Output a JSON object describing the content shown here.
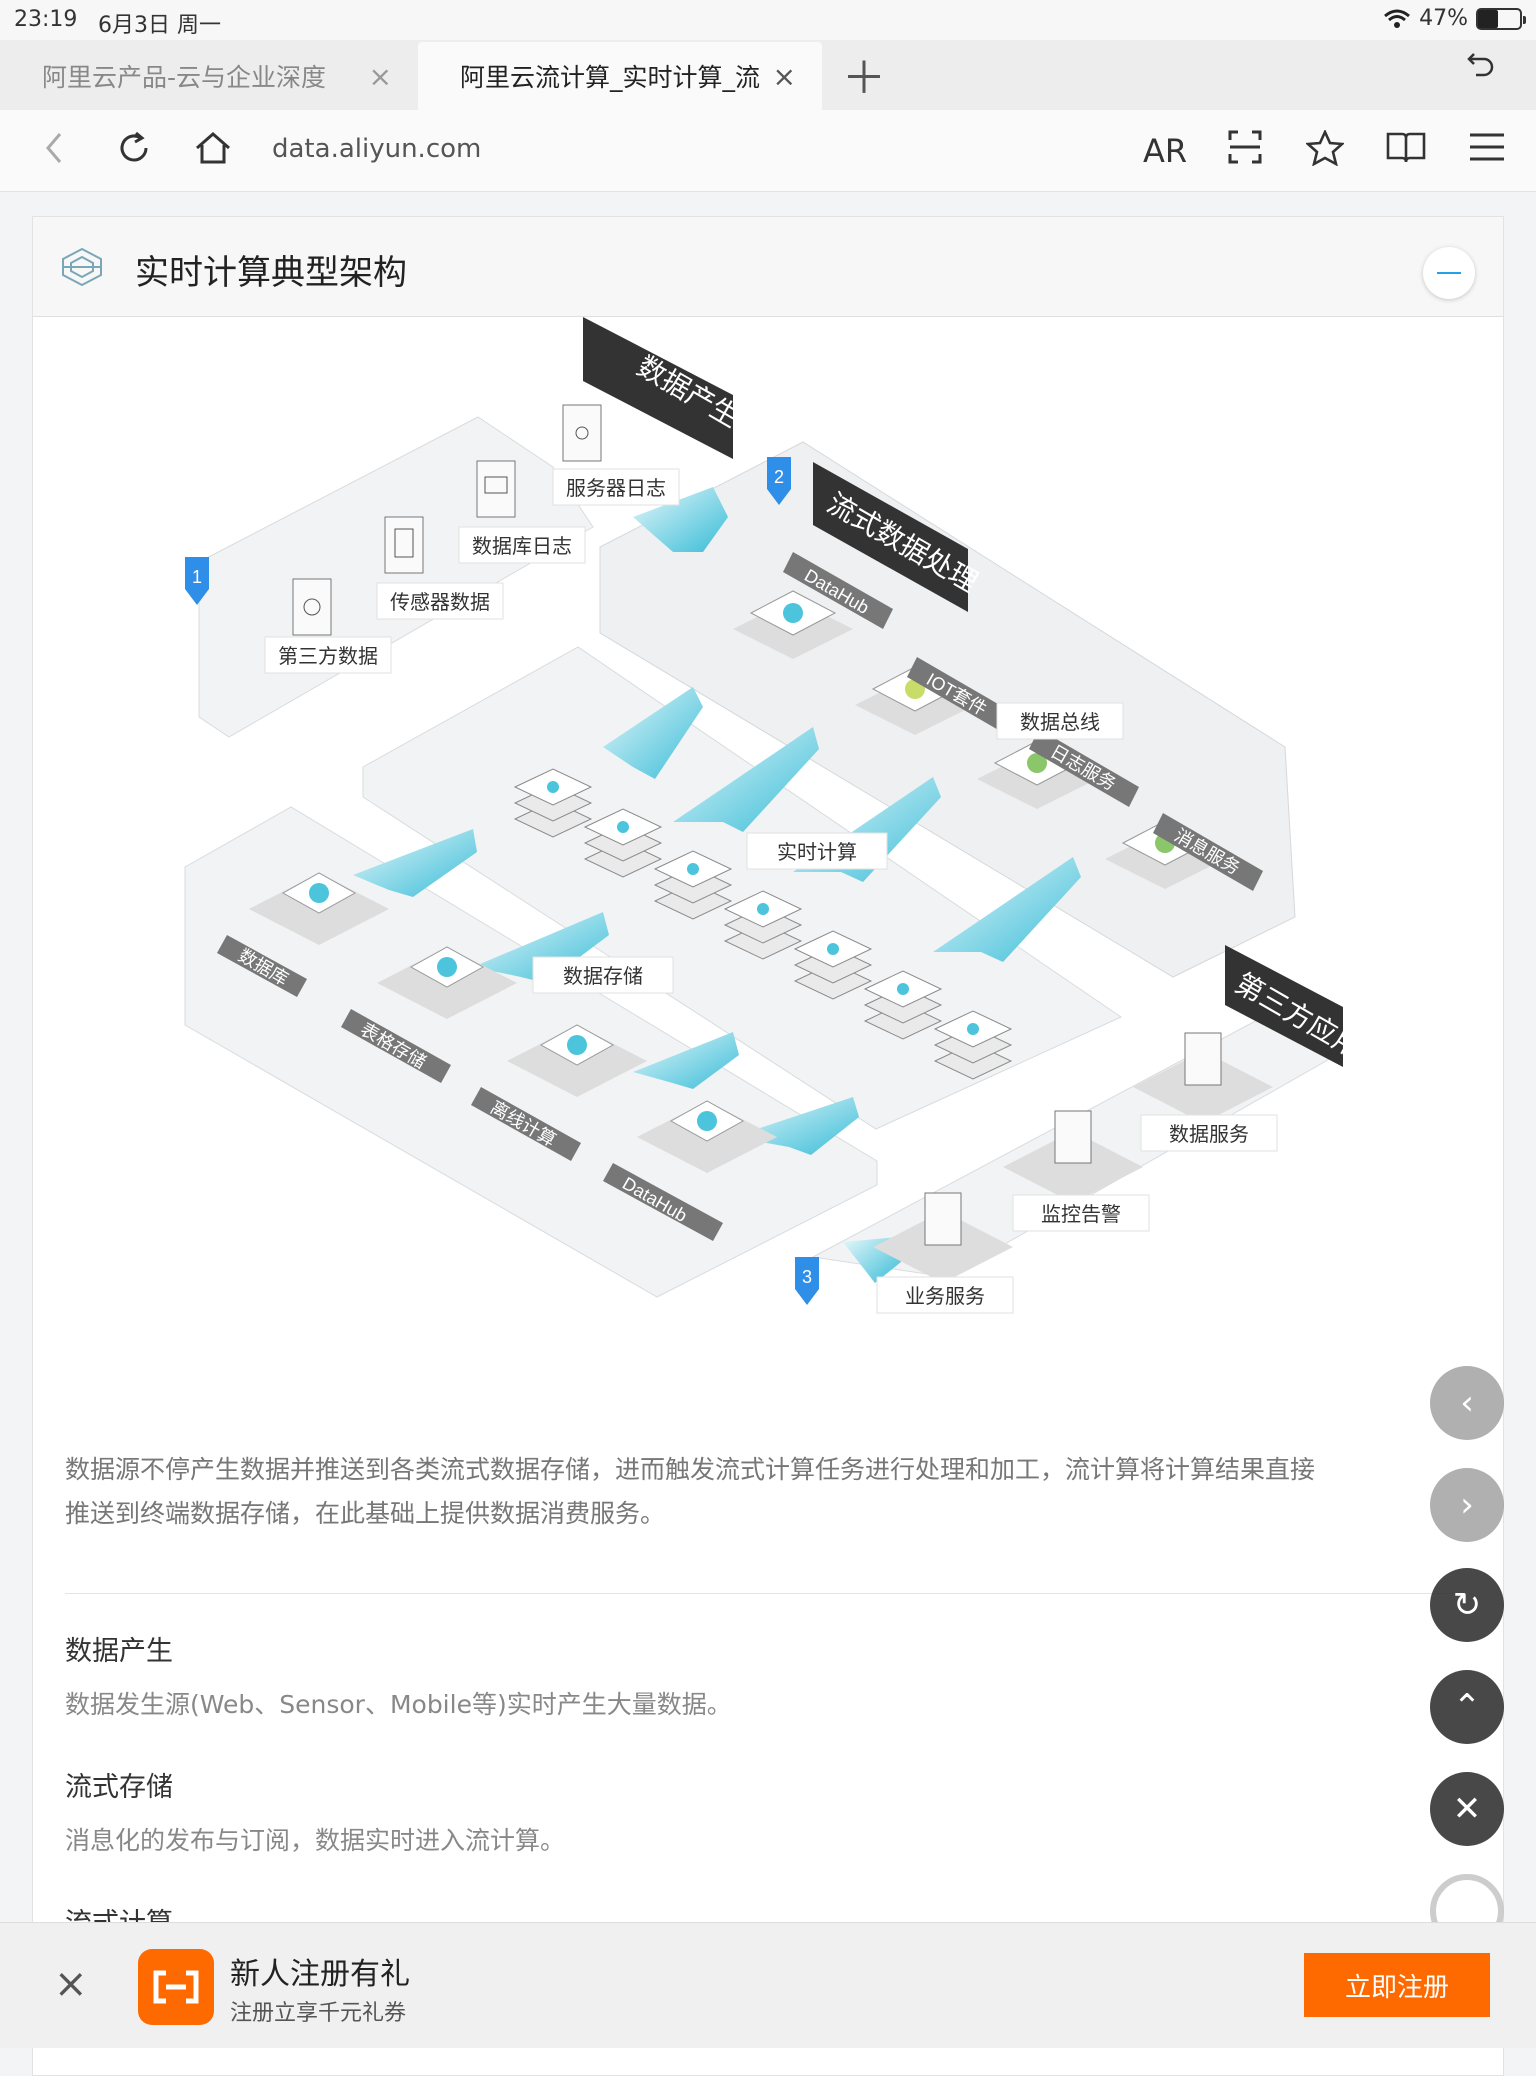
{
  "status": {
    "time": "23:19",
    "date": "6月3日 周一",
    "battery": "47%",
    "battery_level": 0.47
  },
  "tabs": [
    {
      "label": "阿里云产品-云与企业深度"
    },
    {
      "label": "阿里云流计算_实时计算_流"
    }
  ],
  "url": "data.aliyun.com",
  "toolbar": {
    "ar": "AR"
  },
  "card": {
    "title": "实时计算典型架构"
  },
  "diagram": {
    "zones": [
      "数据产生",
      "流式数据处理",
      "第三方应用"
    ],
    "markers": [
      "1",
      "2",
      "3"
    ],
    "sources": [
      "服务器日志",
      "数据库日志",
      "传感器数据",
      "第三方数据"
    ],
    "stream_tags": [
      "DataHub",
      "IOT套件",
      "日志服务",
      "消息服务"
    ],
    "data_bus": "数据总线",
    "compute": "实时计算",
    "storage": "数据存储",
    "storage_tags": [
      "数据库",
      "表格存储",
      "离线计算",
      "DataHub"
    ],
    "apps": [
      "数据服务",
      "监控告警",
      "业务服务"
    ]
  },
  "description": {
    "line1": "数据源不停产生数据并推送到各类流式数据存储，进而触发流式计算任务进行处理和加工，流计算将计算结果直接",
    "line2": "推送到终端数据存储，在此基础上提供数据消费服务。"
  },
  "sections": [
    {
      "title": "数据产生",
      "text": "数据发生源(Web、Sensor、Mobile等)实时产生大量数据。"
    },
    {
      "title": "流式存储",
      "text": "消息化的发布与订阅，数据实时进入流计算。"
    },
    {
      "title": "流式计算",
      "text": ""
    }
  ],
  "banner": {
    "title": "新人注册有礼",
    "subtitle": "注册立享千元礼券",
    "button": "立即注册"
  },
  "colors": {
    "accent": "#ff6a00",
    "arrow": "#4cc4dc",
    "marker": "#2f8fe8"
  }
}
